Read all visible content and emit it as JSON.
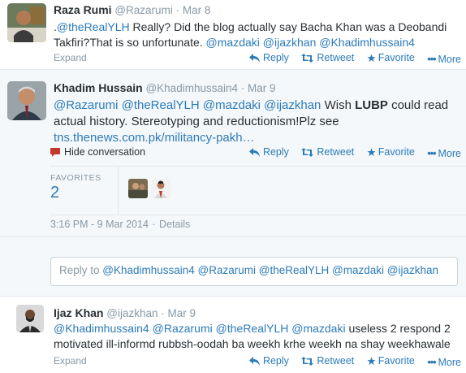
{
  "tweets": [
    {
      "name": "Raza Rumi",
      "handle": "@Razarumi",
      "time": "Mar 8",
      "text_parts": [
        {
          "t": ".",
          "k": "plain"
        },
        {
          "t": "@theRealYLH",
          "k": "link"
        },
        {
          "t": " Really? Did the blog actually say Bacha Khan was a Deobandi Takfiri?That is so unfortunate. ",
          "k": "plain"
        },
        {
          "t": "@mazdaki",
          "k": "link"
        },
        {
          "t": " ",
          "k": "plain"
        },
        {
          "t": "@ijazkhan",
          "k": "link"
        },
        {
          "t": " ",
          "k": "plain"
        },
        {
          "t": "@Khadimhussain4",
          "k": "link"
        }
      ],
      "expand": "Expand"
    },
    {
      "name": "Khadim Hussain",
      "handle": "@Khadimhussain4",
      "time": "Mar 9",
      "text_parts": [
        {
          "t": "@Razarumi",
          "k": "link"
        },
        {
          "t": " ",
          "k": "plain"
        },
        {
          "t": "@theRealYLH",
          "k": "link"
        },
        {
          "t": " ",
          "k": "plain"
        },
        {
          "t": "@mazdaki",
          "k": "link"
        },
        {
          "t": " ",
          "k": "plain"
        },
        {
          "t": "@ijazkhan",
          "k": "link"
        },
        {
          "t": " Wish ",
          "k": "plain"
        },
        {
          "t": "LUBP",
          "k": "bold"
        },
        {
          "t": " could read actual history. Stereotyping and reductionism!Plz see ",
          "k": "plain"
        },
        {
          "t": "tns.thenews.com.pk/militancy-pakh…",
          "k": "link"
        }
      ],
      "hide": "Hide conversation",
      "favorites_label": "FAVORITES",
      "favorites_count": "2",
      "timestamp": "3:16 PM - 9 Mar 2014",
      "details": "Details"
    },
    {
      "name": "Ijaz Khan",
      "handle": "@ijazkhan",
      "time": "Mar 9",
      "text_parts": [
        {
          "t": "@Khadimhussain4",
          "k": "link"
        },
        {
          "t": " ",
          "k": "plain"
        },
        {
          "t": "@Razarumi",
          "k": "link"
        },
        {
          "t": " ",
          "k": "plain"
        },
        {
          "t": "@theRealYLH",
          "k": "link"
        },
        {
          "t": " ",
          "k": "plain"
        },
        {
          "t": "@mazdaki",
          "k": "link"
        },
        {
          "t": " useless 2 respond 2 motivated ill-informd rubbsh-oodah ba weekh krhe weekh na shay weekhawale",
          "k": "plain"
        }
      ],
      "expand": "Expand"
    }
  ],
  "actions": {
    "reply": "Reply",
    "retweet": "Retweet",
    "favorite": "Favorite",
    "more": "More"
  },
  "reply_box": {
    "prefix": "Reply to ",
    "mentions": "@Khadimhussain4 @Razarumi @theRealYLH @mazdaki @ijazkhan"
  },
  "icons": [
    "reply-icon",
    "retweet-icon",
    "favorite-star-icon",
    "more-dots-icon",
    "speech-bubble-icon"
  ],
  "colors": {
    "link": "#2b7bb9",
    "muted": "#8899a6",
    "text": "#292f33",
    "hide_icon": "#c0392b"
  }
}
